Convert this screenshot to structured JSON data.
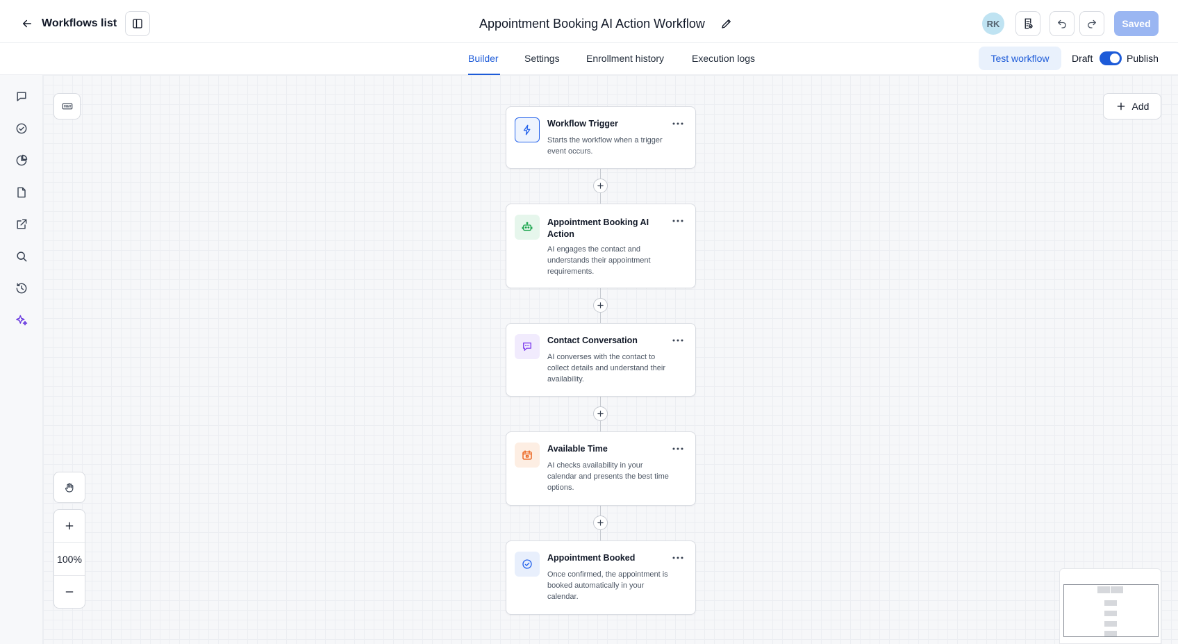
{
  "header": {
    "back_label": "Workflows list",
    "workflow_title": "Appointment Booking AI Action Workflow",
    "avatar_initials": "RK",
    "saved_label": "Saved"
  },
  "tabs": [
    {
      "label": "Builder",
      "active": true
    },
    {
      "label": "Settings",
      "active": false
    },
    {
      "label": "Enrollment history",
      "active": false
    },
    {
      "label": "Execution logs",
      "active": false
    }
  ],
  "actions": {
    "test_label": "Test workflow",
    "draft_label": "Draft",
    "publish_label": "Publish",
    "published": true
  },
  "canvas": {
    "add_label": "Add",
    "zoom_level": "100%"
  },
  "nodes": [
    {
      "title": "Workflow Trigger",
      "desc": "Starts the workflow when a trigger event occurs.",
      "icon": "lightning-icon"
    },
    {
      "title": "Appointment Booking AI Action",
      "desc": "AI engages the contact and understands their appointment requirements.",
      "icon": "robot-icon"
    },
    {
      "title": "Contact Conversation",
      "desc": "AI converses with the contact to collect details and understand their availability.",
      "icon": "chat-icon"
    },
    {
      "title": "Available Time",
      "desc": "AI checks availability in your calendar and presents the best time options.",
      "icon": "calendar-icon"
    },
    {
      "title": "Appointment Booked",
      "desc": "Once confirmed, the appointment is booked automatically in your calendar.",
      "icon": "check-circle-icon"
    }
  ],
  "colors": {
    "accent": "#1d5bd8",
    "trigger": "#2563eb",
    "ai_action": "#16a34a",
    "conversation": "#7c3aed",
    "calendar": "#ea580c",
    "booked": "#2563eb"
  }
}
